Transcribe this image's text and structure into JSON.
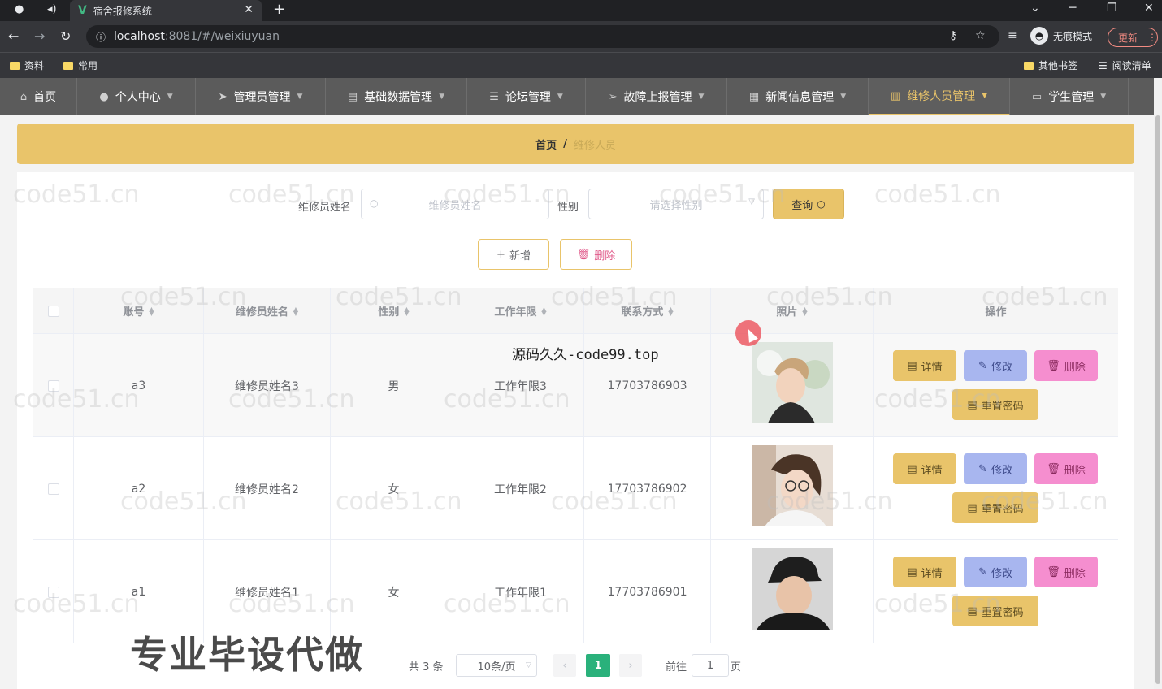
{
  "browser": {
    "tab_title": "宿舍报修系统",
    "url_host": "localhost",
    "url_rest": ":8081/#/weixiuyuan",
    "incognito_label": "无痕模式",
    "update_label": "更新",
    "bookmarks": [
      "资料",
      "常用"
    ],
    "other_bookmarks": "其他书签",
    "reading_list": "阅读清单"
  },
  "nav": {
    "items": [
      {
        "label": "首页",
        "icon": "home-icon"
      },
      {
        "label": "个人中心",
        "icon": "user-icon"
      },
      {
        "label": "管理员管理",
        "icon": "paper-plane-icon"
      },
      {
        "label": "基础数据管理",
        "icon": "data-icon"
      },
      {
        "label": "论坛管理",
        "icon": "sliders-icon"
      },
      {
        "label": "故障上报管理",
        "icon": "send-icon"
      },
      {
        "label": "新闻信息管理",
        "icon": "news-icon"
      },
      {
        "label": "维修人员管理",
        "icon": "stack-icon",
        "active": true
      },
      {
        "label": "学生管理",
        "icon": "monitor-icon"
      }
    ]
  },
  "breadcrumb": {
    "home": "首页",
    "sep": "/",
    "current": "维修人员"
  },
  "search": {
    "name_label": "维修员姓名",
    "name_placeholder": "维修员姓名",
    "gender_label": "性别",
    "gender_placeholder": "请选择性别",
    "query_label": "查询"
  },
  "actions": {
    "add_label": "新增",
    "delete_label": "删除"
  },
  "table": {
    "columns": [
      "账号",
      "维修员姓名",
      "性别",
      "工作年限",
      "联系方式",
      "照片",
      "操作"
    ],
    "rows": [
      {
        "account": "a3",
        "name": "维修员姓名3",
        "gender": "男",
        "years": "工作年限3",
        "phone": "17703786903"
      },
      {
        "account": "a2",
        "name": "维修员姓名2",
        "gender": "女",
        "years": "工作年限2",
        "phone": "17703786902"
      },
      {
        "account": "a1",
        "name": "维修员姓名1",
        "gender": "女",
        "years": "工作年限1",
        "phone": "17703786901"
      }
    ],
    "op_labels": {
      "detail": "详情",
      "edit": "修改",
      "remove": "删除",
      "reset": "重置密码"
    }
  },
  "pagination": {
    "total": "共 3 条",
    "page_size": "10条/页",
    "current": "1",
    "goto_label": "前往",
    "goto_value": "1",
    "page_suffix": "页"
  },
  "overlay": {
    "source_text": "源码久久-code99.top",
    "promo_text": "专业毕设代做",
    "watermark": "code51.cn"
  },
  "colors": {
    "accent": "#e9c46a",
    "nav_bg": "#5b5b5b",
    "pager": "#2ab17b",
    "edit": "#a8b6ef",
    "remove": "#f58ecf"
  }
}
